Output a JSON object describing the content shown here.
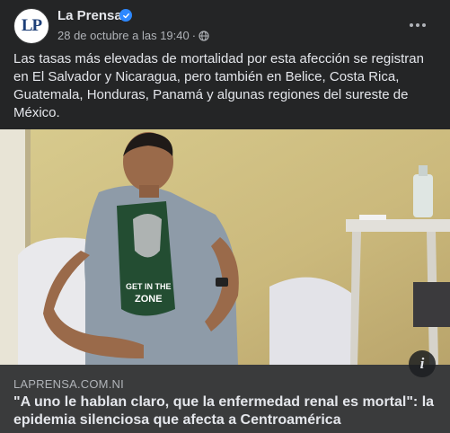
{
  "post": {
    "author": "La Prensa",
    "avatar_text": "LP",
    "timestamp": "28 de octubre a las 19:40",
    "separator": "·",
    "privacy_icon": "globe-icon",
    "more_icon": "more-options-icon",
    "text": "Las tasas más elevadas de mortalidad por esta afección se registran en El Salvador y Nicaragua, pero también en Belice, Costa Rica, Guatemala, Honduras, Panamá y algunas regiones del sureste de México."
  },
  "photo": {
    "shirt_text_1": "GET IN THE",
    "shirt_text_2": "ZONE"
  },
  "link": {
    "domain": "LAPRENSA.COM.NI",
    "title": "\"A uno le hablan claro, que la enfermedad renal es mortal\": la epidemia silenciosa que afecta a Centroamérica",
    "info_label": "i"
  },
  "colors": {
    "background": "#242526",
    "card": "#3a3b3c",
    "text_primary": "#e4e6eb",
    "text_secondary": "#b0b3b8",
    "verified": "#2d88ff"
  }
}
